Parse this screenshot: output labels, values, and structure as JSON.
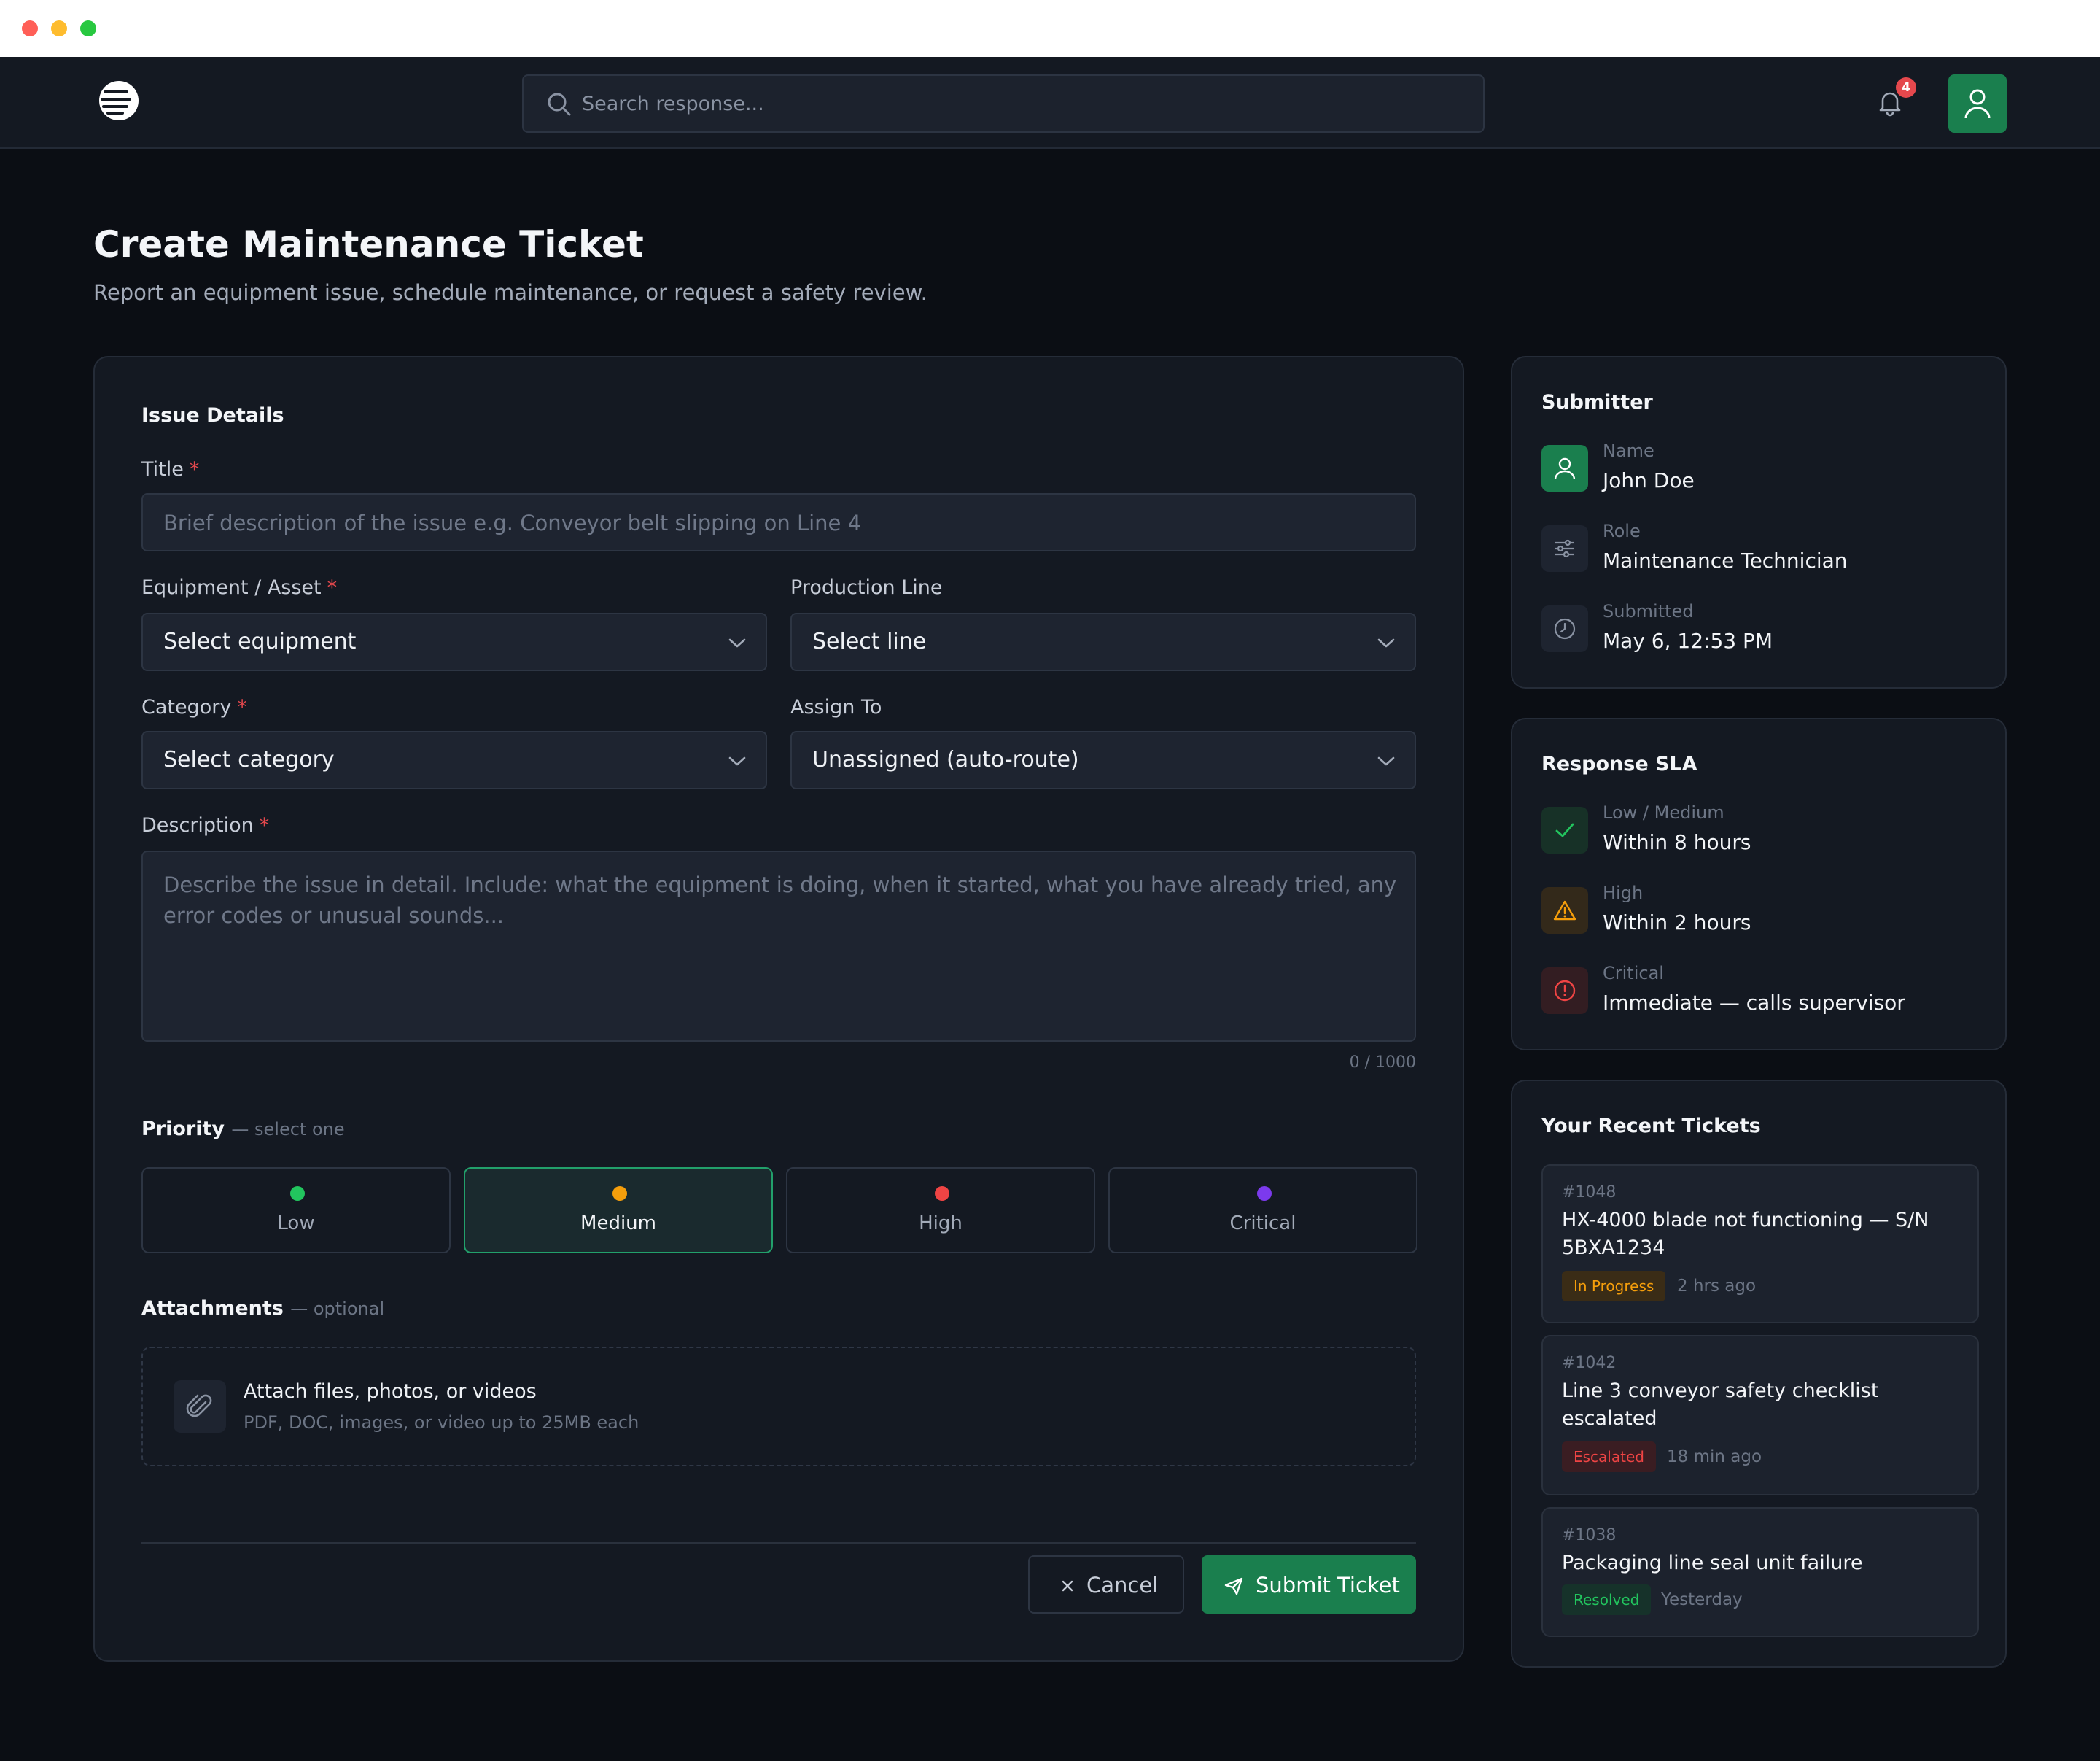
{
  "window": {
    "controls": [
      "close",
      "minimize",
      "maximize"
    ]
  },
  "header": {
    "logo_icon": "brand-logo-icon",
    "search": {
      "placeholder": "Search response..."
    },
    "notifications": {
      "icon": "bell-icon",
      "count": "4"
    },
    "user_icon": "user-icon"
  },
  "page": {
    "title": "Create Maintenance Ticket",
    "subtitle": "Report an equipment issue, schedule maintenance, or request a safety review."
  },
  "form": {
    "section_title": "Issue Details",
    "title_field": {
      "label": "Title",
      "required_mark": "*",
      "placeholder": "Brief description of the issue e.g. Conveyor belt slipping on Line 4"
    },
    "equipment": {
      "label": "Equipment / Asset",
      "required_mark": "*",
      "value": "Select equipment"
    },
    "production_line": {
      "label": "Production Line",
      "value": "Select line"
    },
    "category": {
      "label": "Category",
      "required_mark": "*",
      "value": "Select category"
    },
    "assign_to": {
      "label": "Assign To",
      "value": "Unassigned (auto-route)"
    },
    "description": {
      "label": "Description",
      "required_mark": "*",
      "placeholder": "Describe the issue in detail. Include: what the equipment is doing, when it started, what you have already tried, any error codes or unusual sounds...",
      "counter": "0 / 1000"
    },
    "priority": {
      "label": "Priority",
      "hint": "— select one",
      "selected": "Medium",
      "options": [
        {
          "label": "Low",
          "color": "#22c55e"
        },
        {
          "label": "Medium",
          "color": "#f59e0b"
        },
        {
          "label": "High",
          "color": "#ef4444"
        },
        {
          "label": "Critical",
          "color": "#7c3aed"
        }
      ]
    },
    "attachments": {
      "label": "Attachments",
      "hint": "— optional",
      "icon": "paperclip-icon",
      "title": "Attach files, photos, or videos",
      "subtitle": "PDF, DOC, images, or video up to 25MB each"
    },
    "actions": {
      "cancel": "Cancel",
      "submit": "Submit Ticket"
    }
  },
  "submitter": {
    "title": "Submitter",
    "rows": [
      {
        "icon": "user-icon",
        "key": "Name",
        "value": "John Doe"
      },
      {
        "icon": "sliders-icon",
        "key": "Role",
        "value": "Maintenance Technician"
      },
      {
        "icon": "clock-icon",
        "key": "Submitted",
        "value": "May 6, 12:53 PM"
      }
    ]
  },
  "sla": {
    "title": "Response SLA",
    "rows": [
      {
        "icon": "check-icon",
        "key": "Low / Medium",
        "value": "Within 8 hours"
      },
      {
        "icon": "warning-icon",
        "key": "High",
        "value": "Within 2 hours"
      },
      {
        "icon": "alert-circle-icon",
        "key": "Critical",
        "value": "Immediate — calls supervisor"
      }
    ]
  },
  "recent": {
    "title": "Your Recent Tickets",
    "tickets": [
      {
        "id": "#1048",
        "title": "HX-4000 blade not functioning — S/N 5BXA1234",
        "status": "In Progress",
        "status_color": "#f59e0b",
        "time": "2 hrs ago"
      },
      {
        "id": "#1042",
        "title": "Line 3 conveyor safety checklist escalated",
        "status": "Escalated",
        "status_color": "#ef4444",
        "time": "18 min ago"
      },
      {
        "id": "#1038",
        "title": "Packaging line seal unit failure",
        "status": "Resolved",
        "status_color": "#22c55e",
        "time": "Yesterday"
      }
    ]
  },
  "colors": {
    "accent": "#1a7f4e",
    "background": "#0b0e14",
    "card": "#141922",
    "danger": "#e5484d"
  }
}
